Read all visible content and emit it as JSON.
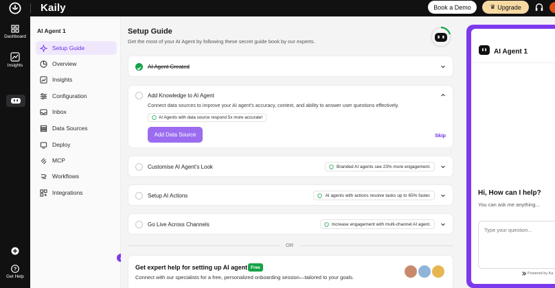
{
  "topbar": {
    "brand": "Kaily",
    "book_demo": "Book a Demo",
    "upgrade": "Upgrade"
  },
  "rail": {
    "dashboard": "Dashboard",
    "insights": "Insights",
    "get_help": "Get Help"
  },
  "sidebar": {
    "agent_name": "AI Agent 1",
    "items": [
      {
        "label": "Setup Guide",
        "icon": "sparkle-icon"
      },
      {
        "label": "Overview",
        "icon": "pie-icon"
      },
      {
        "label": "Insights",
        "icon": "chart-icon"
      },
      {
        "label": "Configuration",
        "icon": "sliders-icon"
      },
      {
        "label": "Inbox",
        "icon": "inbox-icon"
      },
      {
        "label": "Data Sources",
        "icon": "database-icon"
      },
      {
        "label": "Deploy",
        "icon": "deploy-icon"
      },
      {
        "label": "MCP",
        "icon": "mcp-icon"
      },
      {
        "label": "Workflows",
        "icon": "workflow-icon"
      },
      {
        "label": "Integrations",
        "icon": "grid-plus-icon"
      }
    ]
  },
  "main": {
    "title": "Setup Guide",
    "subtitle": "Get the most of your AI Agent by following these secret guide book by our experts.",
    "steps": {
      "created": "AI Agent Created",
      "knowledge": {
        "title": "Add Knowledge to AI Agent",
        "description": "Connect data sources to improve your AI agent's accuracy, context, and ability to answer user questions effectively.",
        "tip": "AI Agents with data source respond 5x more accurate!",
        "button": "Add Data Source",
        "skip": "Skip"
      },
      "customise": {
        "title": "Customise AI Agent's Look",
        "badge": "Branded AI agents see 23% more engagement."
      },
      "actions": {
        "title": "Setup AI Actions",
        "badge": "AI agents with actions resolve tasks up to 65% faster."
      },
      "golive": {
        "title": "Go Live Across Channels",
        "badge": "Increase engagement with multi-channel AI agent."
      }
    },
    "or": "OR",
    "expert": {
      "title": "Get expert help for setting up AI agent",
      "free": "Free",
      "subtitle": "Connect with our specialists for a free, personalized onboarding session—tailored to your goals."
    }
  },
  "preview": {
    "agent_name": "AI Agent 1",
    "greeting": "Hi, How can I help?",
    "greeting_sub": "You can ask me anything...",
    "placeholder": "Type your question...",
    "powered": "Powered by Ka"
  },
  "colors": {
    "accent": "#7c3aed",
    "success": "#16a34a",
    "upgrade": "#f7d9a4"
  }
}
